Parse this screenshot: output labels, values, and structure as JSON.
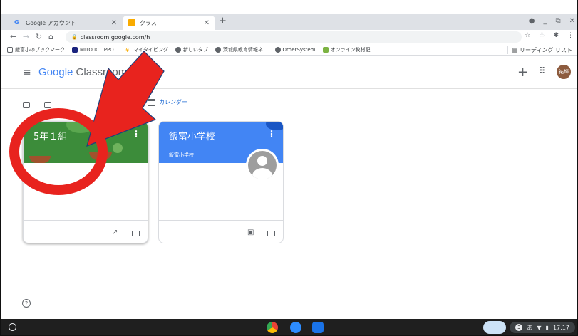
{
  "browser": {
    "tabs": [
      {
        "label": "Google アカウント",
        "active": false
      },
      {
        "label": "クラス",
        "active": true
      }
    ],
    "new_tab": "+",
    "url": "classroom.google.com/h",
    "bookmarks": [
      {
        "label": "飯富小のブックマーク",
        "icon": "bookmark-folder-icon"
      },
      {
        "label": "MITO IC...PPO...",
        "icon": "app-icon"
      },
      {
        "label": "マイタイピング",
        "icon": "typing-icon"
      },
      {
        "label": "新しいタブ",
        "icon": "globe-icon"
      },
      {
        "label": "茨城県教育情報ネ...",
        "icon": "globe-icon"
      },
      {
        "label": "OrderSystem",
        "icon": "globe-icon"
      },
      {
        "label": "オンライン教材配...",
        "icon": "app-icon"
      }
    ],
    "reading_list": "リーディング リスト"
  },
  "app": {
    "logo_google": "Google",
    "logo_product": "Classroom",
    "avatar_initials": "祐輝",
    "calendar_label": "カレンダー"
  },
  "classes": [
    {
      "title": "5年１組",
      "subtitle": "",
      "banner_color": "#3c8c3a"
    },
    {
      "title": "飯富小学校",
      "subtitle": "飯富小学校",
      "banner_color": "#4285f4"
    }
  ],
  "shelf": {
    "time": "17:17",
    "ime": "あ",
    "badge": "3"
  },
  "annotation": {
    "color": "#e8231e"
  }
}
